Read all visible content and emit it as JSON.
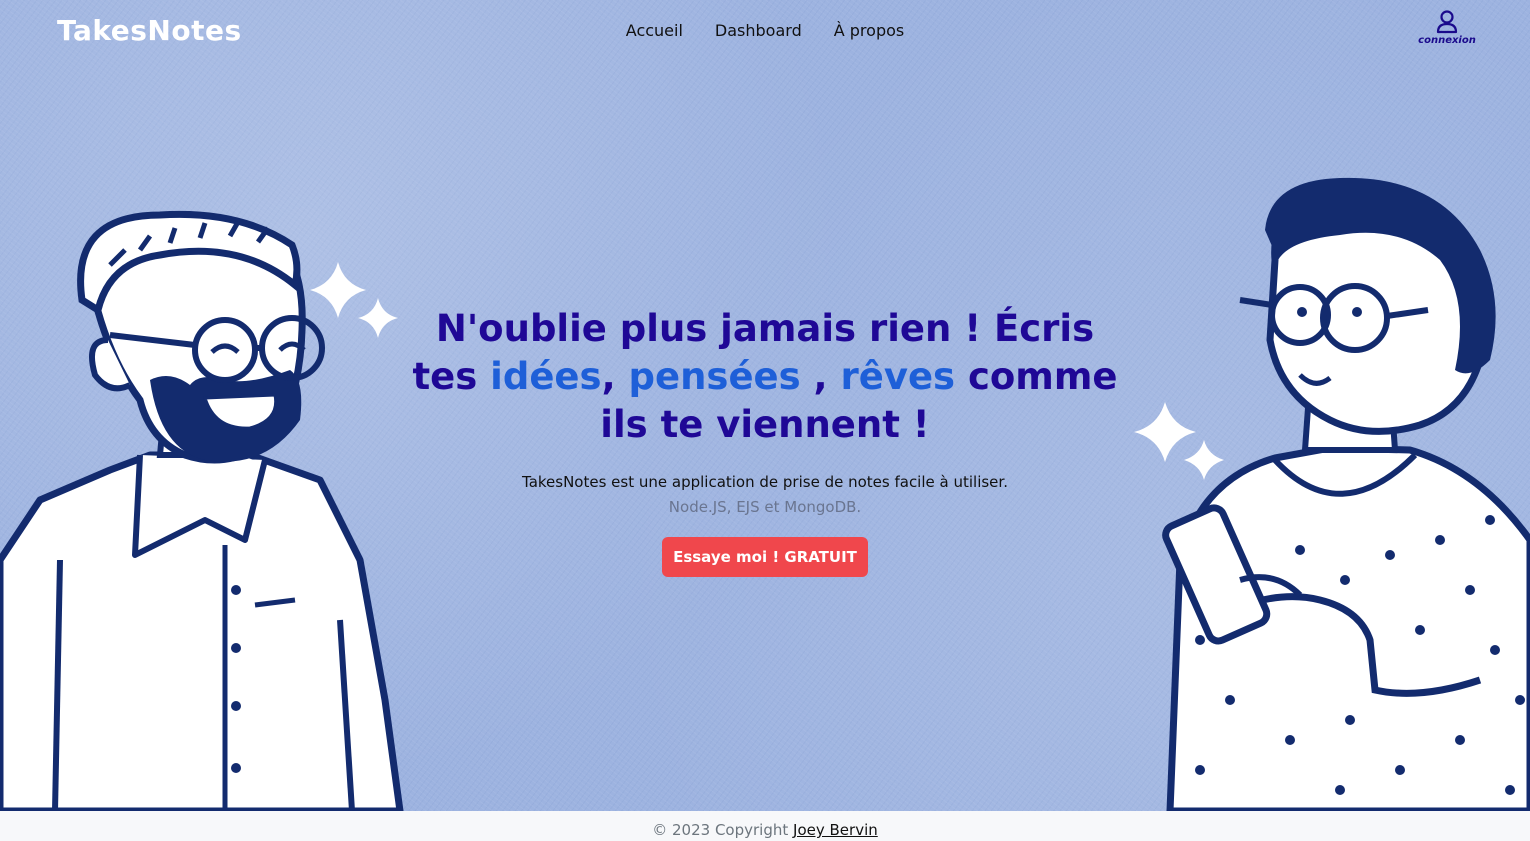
{
  "brand": {
    "name": "TakesNotes"
  },
  "nav": {
    "items": [
      "Accueil",
      "Dashboard",
      "À propos"
    ]
  },
  "account": {
    "label": "connexion",
    "icon": "user-icon"
  },
  "hero": {
    "headline_part1": "N'oublie plus jamais rien ! Écris tes ",
    "highlight1": "idées",
    "sep1": ", ",
    "highlight2": "pensées",
    "sep2": " , ",
    "highlight3": "rêves",
    "headline_part2": " comme ils te viennent !",
    "subtitle": "TakesNotes est une application de prise de notes facile à utiliser.",
    "tech": "Node.JS, EJS et MongoDB.",
    "cta_label": "Essaye moi ! GRATUIT"
  },
  "footer": {
    "copyright": "© 2023 Copyright",
    "author": "Joey Bervin"
  },
  "colors": {
    "background": "#9db3e0",
    "headline": "#1f0896",
    "highlight": "#1e5fd8",
    "cta": "#f0474c",
    "illustration_ink": "#132b6e"
  }
}
